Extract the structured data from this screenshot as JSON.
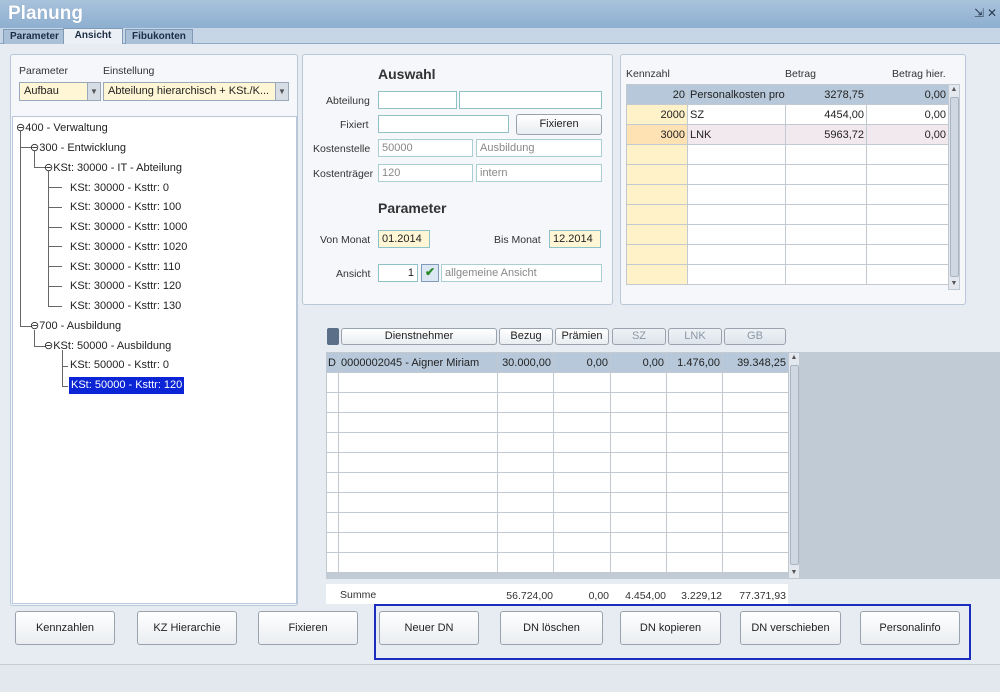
{
  "app": {
    "title": "Planung",
    "minimize_glyph": "⇲",
    "close_glyph": "✕"
  },
  "tabs": [
    "Parameter",
    "Ansicht",
    "Fibukonten"
  ],
  "left": {
    "parameter_label": "Parameter",
    "einstellung_label": "Einstellung",
    "parameter_value": "Aufbau",
    "einstellung_value": "Abteilung hierarchisch + KSt./K...",
    "tree": [
      {
        "label": "400 - Verwaltung",
        "level": 0
      },
      {
        "label": "300 - Entwicklung",
        "level": 1
      },
      {
        "label": "KSt: 30000 - IT - Abteilung",
        "level": 2
      },
      {
        "label": "KSt: 30000 - Ksttr: 0",
        "level": 3
      },
      {
        "label": "KSt: 30000 - Ksttr: 100",
        "level": 3
      },
      {
        "label": "KSt: 30000 - Ksttr: 1000",
        "level": 3
      },
      {
        "label": "KSt: 30000 - Ksttr: 1020",
        "level": 3
      },
      {
        "label": "KSt: 30000 - Ksttr: 110",
        "level": 3
      },
      {
        "label": "KSt: 30000 - Ksttr: 120",
        "level": 3
      },
      {
        "label": "KSt: 30000 - Ksttr: 130",
        "level": 3
      },
      {
        "label": "700 - Ausbildung",
        "level": 1
      },
      {
        "label": "KSt: 50000 - Ausbildung",
        "level": 2
      },
      {
        "label": "KSt: 50000 - Ksttr: 0",
        "level": 3
      },
      {
        "label": "KSt: 50000 - Ksttr: 120",
        "level": 3
      }
    ]
  },
  "auswahl": {
    "title": "Auswahl",
    "abteilung_label": "Abteilung",
    "fixiert_label": "Fixiert",
    "fixieren_button": "Fixieren",
    "kostenstelle_label": "Kostenstelle",
    "kostenstelle_code": "50000",
    "kostenstelle_name": "Ausbildung",
    "kostentraeger_label": "Kostenträger",
    "kostentraeger_code": "120",
    "kostentraeger_name": "intern"
  },
  "parameter": {
    "title": "Parameter",
    "von_label": "Von Monat",
    "von_value": "01.2014",
    "bis_label": "Bis Monat",
    "bis_value": "12.2014",
    "ansicht_label": "Ansicht",
    "ansicht_value": "1",
    "ansicht_name": "allgemeine Ansicht"
  },
  "kennzahl": {
    "headers": [
      "Kennzahl",
      "Betrag",
      "Betrag hier."
    ],
    "rows": [
      {
        "code": "20",
        "name": "Personalkosten pro",
        "betrag": "3278,75",
        "hier": "0,00"
      },
      {
        "code": "2000",
        "name": "SZ",
        "betrag": "4454,00",
        "hier": "0,00"
      },
      {
        "code": "3000",
        "name": "LNK",
        "betrag": "5963,72",
        "hier": "0,00"
      }
    ]
  },
  "dn": {
    "headers": [
      "Dienstnehmer",
      "Bezug",
      "Prämien",
      "SZ",
      "LNK",
      "GB"
    ],
    "rows": [
      {
        "flag": "D",
        "name": "0000002045 - Aigner Miriam",
        "bezug": "30.000,00",
        "praemien": "0,00",
        "sz": "0,00",
        "lnk": "1.476,00",
        "gb": "39.348,25"
      }
    ],
    "summe": {
      "label": "Summe",
      "bezug": "56.724,00",
      "praemien": "0,00",
      "sz": "4.454,00",
      "lnk": "3.229,12",
      "gb": "77.371,93"
    }
  },
  "buttons": [
    "Kennzahlen",
    "KZ Hierarchie",
    "Fixieren",
    "Neuer DN",
    "DN löschen",
    "DN kopieren",
    "DN verschieben",
    "Personalinfo"
  ],
  "colors": {
    "highlight_border": "#1a2dbf",
    "selection": "#0a24d6",
    "yellow_field": "#fff6d5"
  }
}
